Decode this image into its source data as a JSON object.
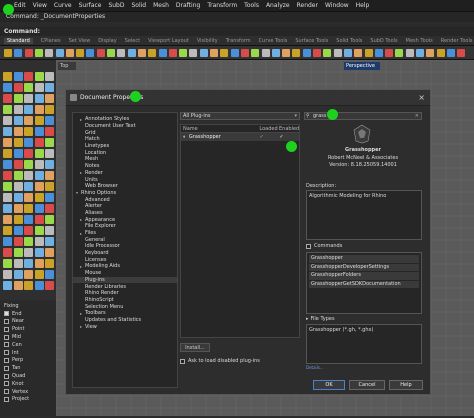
{
  "menubar": [
    "Edit",
    "View",
    "Curve",
    "Surface",
    "SubD",
    "Solid",
    "Mesh",
    "Drafting",
    "Transform",
    "Tools",
    "Analyze",
    "Render",
    "Window",
    "Help"
  ],
  "command_echo": "Command: _DocumentProperties",
  "command_label": "Command:",
  "tabs": [
    "Standard",
    "CPlanes",
    "Set View",
    "Display",
    "Select",
    "Viewport Layout",
    "Visibility",
    "Transform",
    "Curve Tools",
    "Surface Tools",
    "Solid Tools",
    "SubD Tools",
    "Mesh Tools",
    "Render Tools"
  ],
  "viewports": {
    "top": "Top",
    "perspective": "Perspective"
  },
  "osnap": {
    "title": "Fixing",
    "items": [
      {
        "label": "End",
        "checked": true
      },
      {
        "label": "Near",
        "checked": false
      },
      {
        "label": "Point",
        "checked": false
      },
      {
        "label": "Mid",
        "checked": false
      },
      {
        "label": "Cen",
        "checked": false
      },
      {
        "label": "Int",
        "checked": false
      },
      {
        "label": "Perp",
        "checked": false
      },
      {
        "label": "Tan",
        "checked": false
      },
      {
        "label": "Quad",
        "checked": false
      },
      {
        "label": "Knot",
        "checked": false
      },
      {
        "label": "Vertex",
        "checked": false
      },
      {
        "label": "Project",
        "checked": false
      }
    ]
  },
  "dialog": {
    "title": "Document Properties",
    "tree": [
      {
        "label": "Annotation Styles",
        "arrow": "▸",
        "indent": 1
      },
      {
        "label": "Document User Text",
        "arrow": "",
        "indent": 1
      },
      {
        "label": "Grid",
        "arrow": "",
        "indent": 1
      },
      {
        "label": "Hatch",
        "arrow": "",
        "indent": 1
      },
      {
        "label": "Linetypes",
        "arrow": "",
        "indent": 1
      },
      {
        "label": "Location",
        "arrow": "",
        "indent": 1
      },
      {
        "label": "Mesh",
        "arrow": "",
        "indent": 1
      },
      {
        "label": "Notes",
        "arrow": "",
        "indent": 1
      },
      {
        "label": "Render",
        "arrow": "▸",
        "indent": 1
      },
      {
        "label": "Units",
        "arrow": "",
        "indent": 1
      },
      {
        "label": "Web Browser",
        "arrow": "",
        "indent": 1
      },
      {
        "label": "Rhino Options",
        "arrow": "▾",
        "indent": 0
      },
      {
        "label": "Advanced",
        "arrow": "",
        "indent": 1
      },
      {
        "label": "Alerter",
        "arrow": "",
        "indent": 1
      },
      {
        "label": "Aliases",
        "arrow": "",
        "indent": 1
      },
      {
        "label": "Appearance",
        "arrow": "▸",
        "indent": 1
      },
      {
        "label": "File Explorer",
        "arrow": "",
        "indent": 1
      },
      {
        "label": "Files",
        "arrow": "▸",
        "indent": 1
      },
      {
        "label": "General",
        "arrow": "",
        "indent": 1
      },
      {
        "label": "Idle Processor",
        "arrow": "",
        "indent": 1
      },
      {
        "label": "Keyboard",
        "arrow": "",
        "indent": 1
      },
      {
        "label": "Licenses",
        "arrow": "",
        "indent": 1
      },
      {
        "label": "Modeling Aids",
        "arrow": "▸",
        "indent": 1
      },
      {
        "label": "Mouse",
        "arrow": "",
        "indent": 1
      },
      {
        "label": "Plug-ins",
        "arrow": "",
        "indent": 1,
        "selected": true
      },
      {
        "label": "Render Libraries",
        "arrow": "",
        "indent": 1
      },
      {
        "label": "Rhino Render",
        "arrow": "",
        "indent": 1
      },
      {
        "label": "RhinoScript",
        "arrow": "",
        "indent": 1
      },
      {
        "label": "Selection Menu",
        "arrow": "",
        "indent": 1
      },
      {
        "label": "Toolbars",
        "arrow": "▸",
        "indent": 1
      },
      {
        "label": "Updates and Statistics",
        "arrow": "",
        "indent": 1
      },
      {
        "label": "View",
        "arrow": "▸",
        "indent": 1
      }
    ],
    "filter_value": "All Plug-ins",
    "list_headers": {
      "name": "Name",
      "loaded": "Loaded",
      "enabled": "Enabled"
    },
    "plugin_row": {
      "name": "Grasshopper",
      "loaded": "✓",
      "enabled": "✓"
    },
    "install_label": "Install...",
    "ask_label": "Ask to load disabled plug-ins",
    "search_value": "grass",
    "detail": {
      "name": "Grasshopper",
      "author": "Robert McNeel & Associates",
      "version": "Version: 8.18.25059.14001",
      "description_label": "Description:",
      "description": "Algorithmic Modeling for Rhino",
      "commands_label": "Commands",
      "commands": [
        "Grasshopper",
        "GrasshopperDeveloperSettings",
        "GrasshopperFolders",
        "GrasshopperGetSDKDocumentation"
      ],
      "filetypes_label": "File Types",
      "filetypes": "Grasshopper (*.gh, *.ghx)",
      "details_link": "Details..."
    },
    "ok_label": "OK",
    "cancel_label": "Cancel",
    "help_label": "Help"
  },
  "colors": {
    "highlight_marker": "#1fd11f",
    "accent_blue": "#1e3a6a"
  }
}
